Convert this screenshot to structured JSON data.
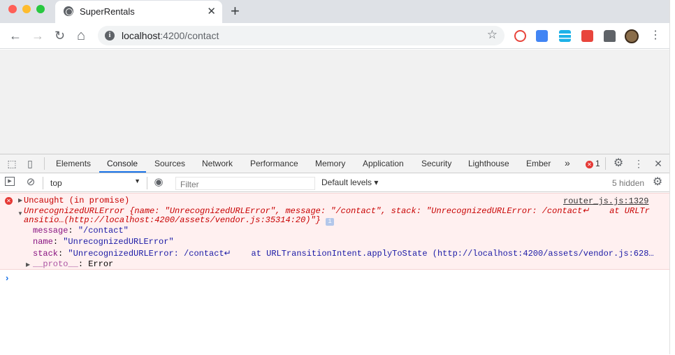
{
  "tab": {
    "title": "SuperRentals",
    "close": "✕"
  },
  "newtab": "+",
  "toolbar": {
    "back": "←",
    "forward": "→",
    "reload": "↻",
    "home": "⌂",
    "url_host": "localhost",
    "url_path": ":4200/contact",
    "star": "☆",
    "menu": "⋮"
  },
  "devtools": {
    "tabs": [
      "Elements",
      "Console",
      "Sources",
      "Network",
      "Performance",
      "Memory",
      "Application",
      "Security",
      "Lighthouse",
      "Ember"
    ],
    "active_tab": "Console",
    "more": "»",
    "error_count": "1",
    "context": "top",
    "filter_placeholder": "Filter",
    "levels": "Default levels ▾",
    "hidden": "5 hidden"
  },
  "console": {
    "error_title": "Uncaught (in promise)",
    "source_link": "router_js.js:1329",
    "summary_line1": "UnrecognizedURLError {name: \"UnrecognizedURLError\", message: \"/contact\", stack: \"UnrecognizedURLError: /contact↵    at URLTr",
    "summary_line2": "ansitio…(http://localhost:4200/assets/vendor.js:35314:20)\"}",
    "props": [
      {
        "key": "message",
        "value": "\"/contact\""
      },
      {
        "key": "name",
        "value": "\"UnrecognizedURLError\""
      },
      {
        "key": "stack",
        "value": "\"UnrecognizedURLError: /contact↵    at URLTransitionIntent.applyToState (http://localhost:4200/assets/vendor.js:628…"
      }
    ],
    "proto_key": "__proto__",
    "proto_value": "Error",
    "prompt": "›"
  },
  "colors": {
    "accent": "#1a73e8",
    "error": "#c80000",
    "error_bg": "#fff0f0"
  }
}
